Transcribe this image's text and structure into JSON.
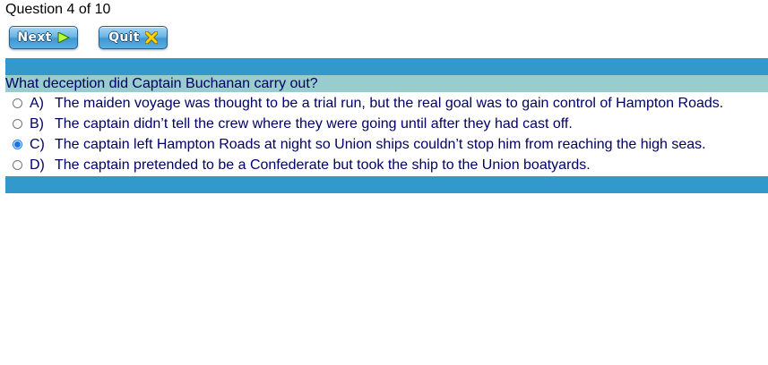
{
  "quiz": {
    "counter": "Question 4 of 10",
    "buttons": {
      "next_label": "Next",
      "quit_label": "Quit"
    },
    "colors": {
      "band": "#3399cc",
      "question_bg": "#99cccc",
      "text": "#000066",
      "next_icon": "#b6ff3a",
      "quit_icon": "#ffd400"
    },
    "icons": {
      "next": "play-triangle-icon",
      "quit": "x-close-icon"
    },
    "question": "What deception did Captain Buchanan carry out?",
    "answers": [
      {
        "letter": "A)",
        "text": "The maiden voyage was thought to be a trial run, but the real goal was to gain control of Hampton Roads.",
        "selected": false
      },
      {
        "letter": "B)",
        "text": "The captain didn’t tell the crew where they were going until after they had cast off.",
        "selected": false
      },
      {
        "letter": "C)",
        "text": "The captain left Hampton Roads at night so Union ships couldn’t stop him from reaching the high seas.",
        "selected": true
      },
      {
        "letter": "D)",
        "text": "The captain pretended to be a Confederate but took the ship to the Union boatyards.",
        "selected": false
      }
    ]
  }
}
